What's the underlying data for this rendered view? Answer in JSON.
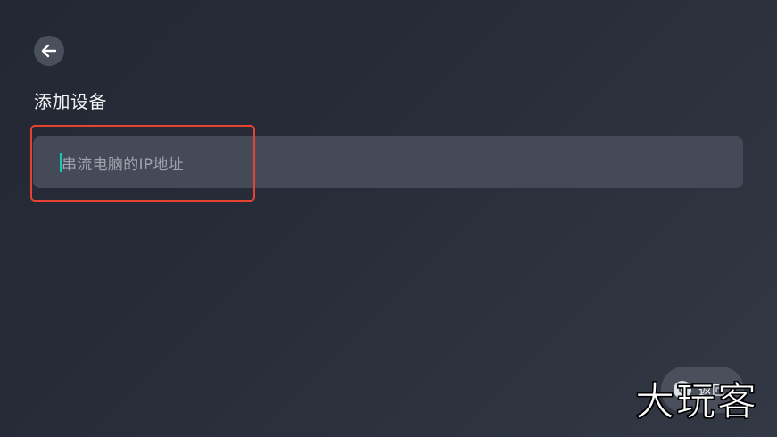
{
  "header": {
    "back_icon": "arrow-left-icon",
    "title": "添加设备"
  },
  "form": {
    "ip_placeholder": "串流电脑的IP地址",
    "ip_value": "",
    "caret_color": "#17c8b6"
  },
  "annotation": {
    "highlight_color": "#e5432f"
  },
  "footer": {
    "return_label": "返回",
    "return_icon": "remote-button-icon"
  },
  "watermark": {
    "text": "大玩客"
  }
}
